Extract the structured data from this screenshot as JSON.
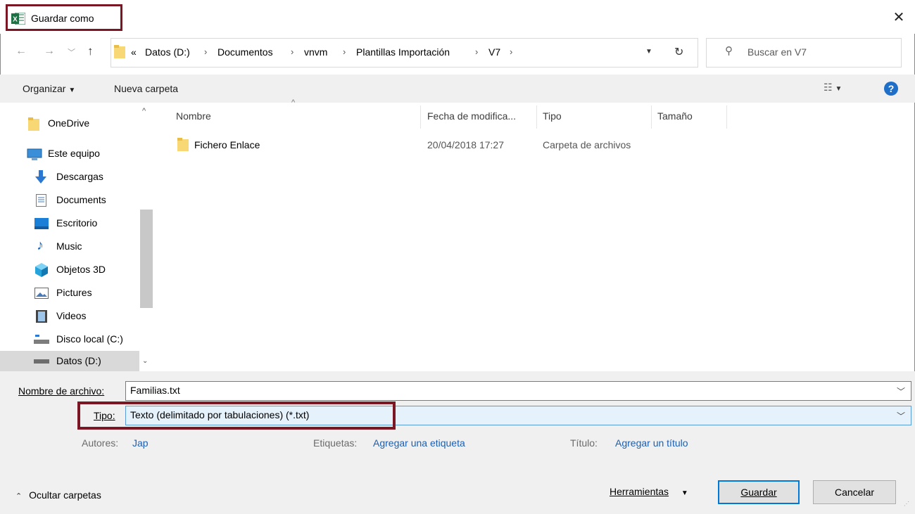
{
  "window": {
    "title": "Guardar como",
    "highlight_color": "#7b1624",
    "accent_color": "#0078d7"
  },
  "nav": {
    "breadcrumb": [
      "Datos (D:)",
      "Documentos",
      "vnvm",
      "Plantillas Importación",
      "V7"
    ],
    "overflow": "«",
    "search_placeholder": "Buscar en V7"
  },
  "toolbar": {
    "organize_label": "Organizar",
    "new_folder_label": "Nueva carpeta",
    "help_label": "?"
  },
  "sidebar": {
    "items": [
      {
        "label": "OneDrive",
        "icon": "folder-icon"
      },
      {
        "label": "Este equipo",
        "icon": "computer-icon"
      },
      {
        "label": "Descargas",
        "icon": "download-icon"
      },
      {
        "label": "Documents",
        "icon": "document-icon"
      },
      {
        "label": "Escritorio",
        "icon": "desktop-icon"
      },
      {
        "label": "Music",
        "icon": "music-icon"
      },
      {
        "label": "Objetos 3D",
        "icon": "cube-icon"
      },
      {
        "label": "Pictures",
        "icon": "pictures-icon"
      },
      {
        "label": "Videos",
        "icon": "video-icon"
      },
      {
        "label": "Disco local (C:)",
        "icon": "drive-icon"
      },
      {
        "label": "Datos (D:)",
        "icon": "drive-icon"
      }
    ],
    "selected": "Datos (D:)"
  },
  "file_list": {
    "columns": [
      "Nombre",
      "Fecha de modifica...",
      "Tipo",
      "Tamaño"
    ],
    "rows": [
      {
        "name": "Fichero Enlace",
        "modified": "20/04/2018 17:27",
        "type": "Carpeta de archivos",
        "size": ""
      }
    ]
  },
  "save": {
    "filename_label": "Nombre de archivo:",
    "filename_value": "Familias.txt",
    "type_label": "Tipo:",
    "type_value": "Texto (delimitado por tabulaciones) (*.txt)",
    "authors_label": "Autores:",
    "authors_value": "Jap",
    "tags_label": "Etiquetas:",
    "tags_value": "Agregar una etiqueta",
    "title_label": "Título:",
    "title_value": "Agregar un título"
  },
  "footer": {
    "hide_folders_label": "Ocultar carpetas",
    "tools_label": "Herramientas",
    "save_button": "Guardar",
    "cancel_button": "Cancelar"
  }
}
